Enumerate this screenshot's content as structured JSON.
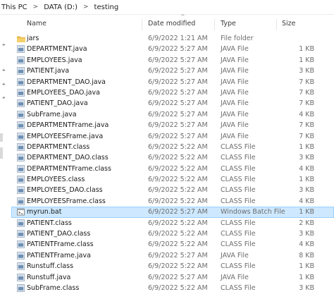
{
  "breadcrumb": {
    "items": [
      "This PC",
      "DATA (D:)",
      "testing"
    ],
    "separator": ">"
  },
  "columns": {
    "name": "Name",
    "date": "Date modified",
    "type": "Type",
    "size": "Size",
    "sort_indicator": "^"
  },
  "colors": {
    "selected_bg": "#cde8ff",
    "selected_border": "#99d1ff",
    "folder": "#e8b84a"
  },
  "files": [
    {
      "name": "jars",
      "date": "6/9/2022 1:21 AM",
      "type": "File folder",
      "size": "",
      "icon": "folder-icon"
    },
    {
      "name": "DEPARTMENT.java",
      "date": "6/9/2022 5:27 AM",
      "type": "JAVA File",
      "size": "1 KB",
      "icon": "java-file-icon"
    },
    {
      "name": "EMPLOYEES.java",
      "date": "6/9/2022 5:27 AM",
      "type": "JAVA File",
      "size": "1 KB",
      "icon": "java-file-icon"
    },
    {
      "name": "PATIENT.java",
      "date": "6/9/2022 5:27 AM",
      "type": "JAVA File",
      "size": "3 KB",
      "icon": "java-file-icon"
    },
    {
      "name": "DEPARTMENT_DAO.java",
      "date": "6/9/2022 5:27 AM",
      "type": "JAVA File",
      "size": "7 KB",
      "icon": "java-file-icon"
    },
    {
      "name": "EMPLOYEES_DAO.java",
      "date": "6/9/2022 5:27 AM",
      "type": "JAVA File",
      "size": "7 KB",
      "icon": "java-file-icon"
    },
    {
      "name": "PATIENT_DAO.java",
      "date": "6/9/2022 5:27 AM",
      "type": "JAVA File",
      "size": "7 KB",
      "icon": "java-file-icon"
    },
    {
      "name": "SubFrame.java",
      "date": "6/9/2022 5:27 AM",
      "type": "JAVA File",
      "size": "4 KB",
      "icon": "java-file-icon"
    },
    {
      "name": "DEPARTMENTFrame.java",
      "date": "6/9/2022 5:27 AM",
      "type": "JAVA File",
      "size": "7 KB",
      "icon": "java-file-icon"
    },
    {
      "name": "EMPLOYEESFrame.java",
      "date": "6/9/2022 5:27 AM",
      "type": "JAVA File",
      "size": "7 KB",
      "icon": "java-file-icon"
    },
    {
      "name": "DEPARTMENT.class",
      "date": "6/9/2022 5:22 AM",
      "type": "CLASS File",
      "size": "1 KB",
      "icon": "class-file-icon"
    },
    {
      "name": "DEPARTMENT_DAO.class",
      "date": "6/9/2022 5:22 AM",
      "type": "CLASS File",
      "size": "3 KB",
      "icon": "class-file-icon"
    },
    {
      "name": "DEPARTMENTFrame.class",
      "date": "6/9/2022 5:22 AM",
      "type": "CLASS File",
      "size": "4 KB",
      "icon": "class-file-icon"
    },
    {
      "name": "EMPLOYEES.class",
      "date": "6/9/2022 5:22 AM",
      "type": "CLASS File",
      "size": "1 KB",
      "icon": "class-file-icon"
    },
    {
      "name": "EMPLOYEES_DAO.class",
      "date": "6/9/2022 5:22 AM",
      "type": "CLASS File",
      "size": "3 KB",
      "icon": "class-file-icon"
    },
    {
      "name": "EMPLOYEESFrame.class",
      "date": "6/9/2022 5:22 AM",
      "type": "CLASS File",
      "size": "4 KB",
      "icon": "class-file-icon"
    },
    {
      "name": "myrun.bat",
      "date": "6/9/2022 5:27 AM",
      "type": "Windows Batch File",
      "size": "1 KB",
      "icon": "batch-file-icon",
      "selected": true
    },
    {
      "name": "PATIENT.class",
      "date": "6/9/2022 5:22 AM",
      "type": "CLASS File",
      "size": "2 KB",
      "icon": "class-file-icon"
    },
    {
      "name": "PATIENT_DAO.class",
      "date": "6/9/2022 5:22 AM",
      "type": "CLASS File",
      "size": "3 KB",
      "icon": "class-file-icon"
    },
    {
      "name": "PATIENTFrame.class",
      "date": "6/9/2022 5:22 AM",
      "type": "CLASS File",
      "size": "4 KB",
      "icon": "class-file-icon"
    },
    {
      "name": "PATIENTFrame.java",
      "date": "6/9/2022 5:27 AM",
      "type": "JAVA File",
      "size": "8 KB",
      "icon": "java-file-icon"
    },
    {
      "name": "Runstuff.class",
      "date": "6/9/2022 5:22 AM",
      "type": "CLASS File",
      "size": "1 KB",
      "icon": "class-file-icon"
    },
    {
      "name": "Runstuff.java",
      "date": "6/9/2022 5:27 AM",
      "type": "JAVA File",
      "size": "1 KB",
      "icon": "java-file-icon"
    },
    {
      "name": "SubFrame.class",
      "date": "6/9/2022 5:22 AM",
      "type": "CLASS File",
      "size": "3 KB",
      "icon": "class-file-icon"
    }
  ]
}
